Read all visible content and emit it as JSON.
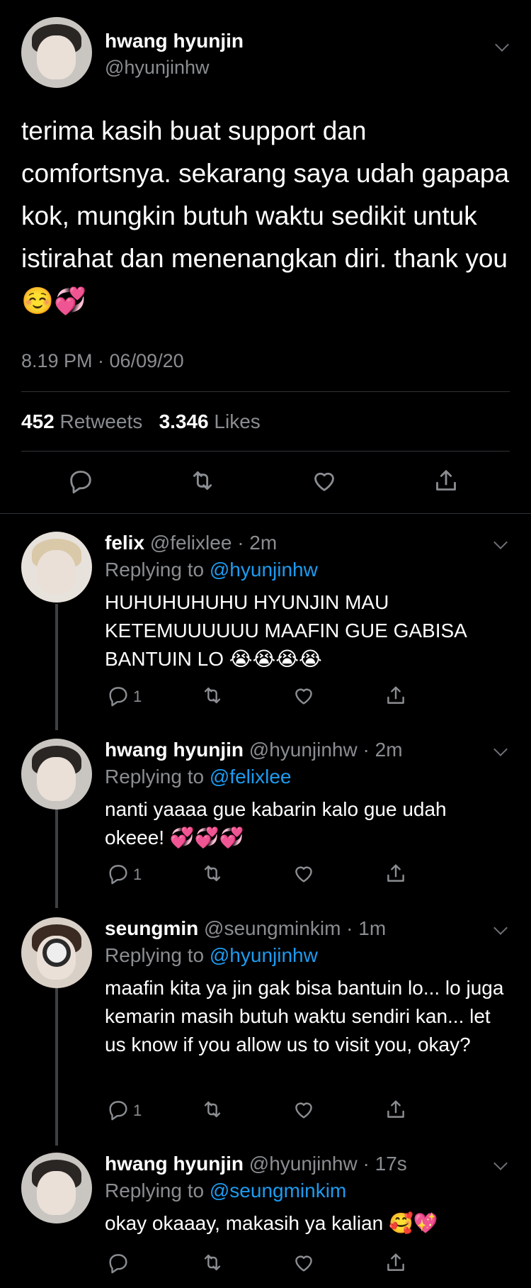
{
  "tweet": {
    "name": "hwang hyunjin",
    "handle": "@hyunjinhw",
    "text": "terima kasih buat support dan comfortsnya. sekarang saya udah gapapa kok, mungkin butuh waktu sedikit untuk istirahat dan menenangkan diri. thank you ☺️💞",
    "timestamp": "8.19 PM · 06/09/20",
    "retweets": "452",
    "retweets_label": "Retweets",
    "likes": "3.346",
    "likes_label": "Likes"
  },
  "replies": [
    {
      "name": "felix",
      "handle": "@felixlee",
      "time": "· 2m",
      "replying_prefix": "Replying to",
      "replying_to": "@hyunjinhw",
      "text": "HUHUHUHUHU HYUNJIN MAU KETEMUUUUUU MAAFIN GUE GABISA BANTUIN LO 😭😭😭😭",
      "reply_count": "1"
    },
    {
      "name": "hwang hyunjin",
      "handle": "@hyunjinhw",
      "time": "· 2m",
      "replying_prefix": "Replying to",
      "replying_to": "@felixlee",
      "text": "nanti yaaaa gue kabarin kalo gue udah okeee! 💞💞💞",
      "reply_count": "1"
    },
    {
      "name": "seungmin",
      "handle": "@seungminkim",
      "time": "· 1m",
      "replying_prefix": "Replying to",
      "replying_to": "@hyunjinhw",
      "text": "maafin kita ya jin gak bisa bantuin lo... lo juga kemarin masih butuh waktu sendiri kan... let us know if you allow us to visit you, okay?",
      "reply_count": "1"
    },
    {
      "name": "hwang hyunjin",
      "handle": "@hyunjinhw",
      "time": "· 17s",
      "replying_prefix": "Replying to",
      "replying_to": "@seungminkim",
      "text": "okay okaaay, makasih ya kalian 🥰💖",
      "reply_count": ""
    }
  ],
  "icons": {
    "reply": "reply-icon",
    "retweet": "retweet-icon",
    "like": "heart-icon",
    "share": "share-icon",
    "more": "chevron-down-icon"
  },
  "colors": {
    "background": "#000000",
    "secondary_text": "#8a8d91",
    "link": "#1d9bf0",
    "divider": "#2f3336"
  }
}
